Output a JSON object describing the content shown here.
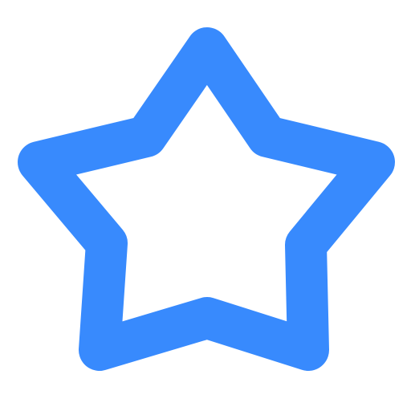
{
  "icon": {
    "name": "star-outline-icon",
    "style": "outline",
    "stroke_color": "#388AFD",
    "fill_color": "#ffffff"
  },
  "background_color": "#ffffff"
}
